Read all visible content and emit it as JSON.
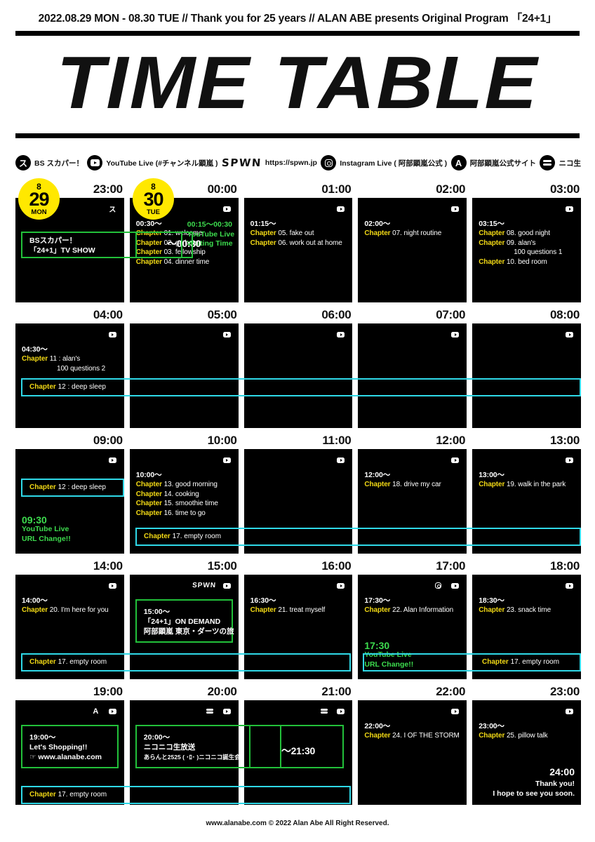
{
  "header": {
    "headline": "2022.08.29 MON - 08.30 TUE // Thank you for 25 years // ALAN ABE presents Original Program 「24+1」",
    "title": "TIME TABLE"
  },
  "legend": [
    {
      "icon": "skyperfectv-icon",
      "glyph": "ス",
      "label": "BS スカパー！"
    },
    {
      "icon": "youtube-icon",
      "glyph": "",
      "label": "YouTube Live (#チャンネル顕嵐 )"
    },
    {
      "icon": "spwn-logo",
      "glyph": "SPWN",
      "label": "https://spwn.jp"
    },
    {
      "icon": "instagram-icon",
      "glyph": "",
      "label": "Instagram Live ( 阿部顕嵐公式 )"
    },
    {
      "icon": "alanabe-site-icon",
      "glyph": "A",
      "label": "阿部顕嵐公式サイト"
    },
    {
      "icon": "niconico-icon",
      "glyph": "",
      "label": "ニコ生"
    }
  ],
  "day_badges": [
    {
      "month": "8",
      "day": "29",
      "weekday": "MON"
    },
    {
      "month": "8",
      "day": "30",
      "weekday": "TUE"
    }
  ],
  "colors": {
    "accent_yellow": "#ffe800",
    "chapter_yellow": "#f2d915",
    "green": "#22c03a",
    "green_text": "#3ddc4e",
    "cyan": "#2fd9e8",
    "cell_bg": "#000000"
  },
  "rows": [
    {
      "times": [
        "23:00",
        "00:00",
        "01:00",
        "02:00",
        "03:00"
      ],
      "cells": [
        {
          "name": "cell-2300",
          "icons": [
            "skyperfectv-icon"
          ],
          "lines": []
        },
        {
          "name": "cell-0000",
          "icons": [
            "youtube-icon"
          ],
          "start": "00:30〜",
          "lines": [
            {
              "ch": "Chapter",
              "txt": " 01. welcome"
            },
            {
              "ch": "Chapter",
              "txt": " 02. go home"
            },
            {
              "ch": "Chapter",
              "txt": " 03. fellowship"
            },
            {
              "ch": "Chapter",
              "txt": " 04. dinner time"
            }
          ],
          "green_note": [
            "00:15〜00:30",
            "YouTube Live",
            "Waiting Time"
          ],
          "box_time": "〜00:30"
        },
        {
          "name": "cell-0100",
          "icons": [
            "youtube-icon"
          ],
          "start": "01:15〜",
          "lines": [
            {
              "ch": "Chapter",
              "txt": " 05. fake out"
            },
            {
              "ch": "Chapter",
              "txt": " 06. work out at home"
            }
          ]
        },
        {
          "name": "cell-0200",
          "icons": [
            "youtube-icon"
          ],
          "start": "02:00〜",
          "lines": [
            {
              "ch": "Chapter",
              "txt": " 07. night routine"
            }
          ]
        },
        {
          "name": "cell-0300",
          "icons": [
            "youtube-icon"
          ],
          "start": "03:15〜",
          "lines": [
            {
              "ch": "Chapter",
              "txt": " 08. good night"
            },
            {
              "ch": "Chapter",
              "txt": " 09. alan's"
            },
            {
              "ch": "",
              "txt": "100 questions 1",
              "indent": true
            },
            {
              "ch": "Chapter",
              "txt": " 10. bed room"
            }
          ]
        }
      ],
      "skyper_box": {
        "l1": "BSスカパー！",
        "l2": "「24+1」TV SHOW"
      }
    },
    {
      "times": [
        "04:00",
        "05:00",
        "06:00",
        "07:00",
        "08:00"
      ],
      "cells": [
        {
          "name": "cell-0400",
          "icons": [
            "youtube-icon"
          ],
          "start": "04:30〜",
          "lines": [
            {
              "ch": "Chapter",
              "txt": " 11 : alan's"
            },
            {
              "ch": "",
              "txt": "100 questions 2",
              "indent": true
            }
          ]
        },
        {
          "name": "cell-0500",
          "icons": [
            "youtube-icon"
          ],
          "lines": []
        },
        {
          "name": "cell-0600",
          "icons": [
            "youtube-icon"
          ],
          "lines": []
        },
        {
          "name": "cell-0700",
          "icons": [
            "youtube-icon"
          ],
          "lines": []
        },
        {
          "name": "cell-0800",
          "icons": [
            "youtube-icon"
          ],
          "lines": []
        }
      ],
      "cyan_bar": {
        "ch": "Chapter",
        "txt": " 12 : deep sleep"
      }
    },
    {
      "times": [
        "09:00",
        "10:00",
        "11:00",
        "12:00",
        "13:00"
      ],
      "cells": [
        {
          "name": "cell-0900",
          "icons": [
            "youtube-icon"
          ],
          "green_note": [
            "09:30",
            "YouTube Live",
            "URL Change!!"
          ],
          "lines": []
        },
        {
          "name": "cell-1000",
          "icons": [
            "youtube-icon"
          ],
          "start": "10:00〜",
          "lines": [
            {
              "ch": "Chapter",
              "txt": " 13. good morning"
            },
            {
              "ch": "Chapter",
              "txt": " 14. cooking"
            },
            {
              "ch": "Chapter",
              "txt": " 15. smoothie time"
            },
            {
              "ch": "Chapter",
              "txt": " 16. time to go"
            }
          ]
        },
        {
          "name": "cell-1100",
          "icons": [
            "youtube-icon"
          ],
          "lines": []
        },
        {
          "name": "cell-1200",
          "icons": [
            "youtube-icon"
          ],
          "start": "12:00〜",
          "lines": [
            {
              "ch": "Chapter",
              "txt": " 18. drive my car"
            }
          ]
        },
        {
          "name": "cell-1300",
          "icons": [
            "youtube-icon"
          ],
          "start": "13:00〜",
          "lines": [
            {
              "ch": "Chapter",
              "txt": " 19. walk in the park"
            }
          ]
        }
      ],
      "cyan_bar_top": {
        "ch": "Chapter",
        "txt": " 12 : deep sleep"
      },
      "cyan_bar": {
        "ch": "Chapter",
        "txt": " 17. empty room"
      }
    },
    {
      "times": [
        "14:00",
        "15:00",
        "16:00",
        "17:00",
        "18:00"
      ],
      "cells": [
        {
          "name": "cell-1400",
          "icons": [
            "youtube-icon"
          ],
          "start": "14:00〜",
          "lines": [
            {
              "ch": "Chapter",
              "txt": " 20. I'm here for you"
            }
          ]
        },
        {
          "name": "cell-1500",
          "icons": [
            "spwn-logo",
            "youtube-icon"
          ],
          "green_box": [
            "15:00〜",
            "「24+1」ON DEMAND",
            "阿部顕嵐 東京・ダーツの旅"
          ],
          "lines": []
        },
        {
          "name": "cell-1600",
          "icons": [
            "youtube-icon"
          ],
          "start": "16:30〜",
          "lines": [
            {
              "ch": "Chapter",
              "txt": " 21. treat myself"
            }
          ]
        },
        {
          "name": "cell-1700",
          "icons": [
            "instagram-icon",
            "youtube-icon"
          ],
          "start": "17:30〜",
          "lines": [
            {
              "ch": "Chapter",
              "txt": " 22. Alan Information"
            }
          ],
          "green_note": [
            "17:30",
            "YouTube Live",
            "URL Change!!"
          ]
        },
        {
          "name": "cell-1800",
          "icons": [
            "youtube-icon"
          ],
          "start": "18:30〜",
          "lines": [
            {
              "ch": "Chapter",
              "txt": " 23. snack time"
            }
          ]
        }
      ],
      "cyan_bar": {
        "ch": "Chapter",
        "txt": " 17. empty room"
      },
      "cyan_bar_right": {
        "ch": "Chapter",
        "txt": " 17. empty room"
      }
    },
    {
      "times": [
        "19:00",
        "20:00",
        "21:00",
        "22:00",
        "23:00"
      ],
      "cells": [
        {
          "name": "cell-1900",
          "icons": [
            "alanabe-site-icon",
            "youtube-icon"
          ],
          "green_box": [
            "19:00〜",
            "Let's Shopping!!",
            "☞ www.alanabe.com"
          ],
          "lines": []
        },
        {
          "name": "cell-2000",
          "icons": [
            "niconico-icon",
            "youtube-icon"
          ],
          "green_box": [
            "20:00〜",
            "ニコニコ生放送",
            "あらんと2525 ( ･ﾛ･ )ニコニコ誕生会"
          ],
          "lines": []
        },
        {
          "name": "cell-2100",
          "icons": [
            "niconico-icon",
            "youtube-icon"
          ],
          "box_time": "〜21:30",
          "lines": []
        },
        {
          "name": "cell-2200",
          "icons": [
            "youtube-icon"
          ],
          "start": "22:00〜",
          "lines": [
            {
              "ch": "Chapter",
              "txt": " 24. I OF THE STORM"
            }
          ]
        },
        {
          "name": "cell-2300",
          "icons": [
            "youtube-icon"
          ],
          "start": "23:00〜",
          "lines": [
            {
              "ch": "Chapter",
              "txt": " 25. pillow talk"
            }
          ],
          "ending": [
            "24:00",
            "Thank you!",
            "I  hope to see you soon."
          ]
        }
      ],
      "cyan_bar": {
        "ch": "Chapter",
        "txt": " 17. empty room"
      }
    }
  ],
  "footer": "www.alanabe.com © 2022 Alan Abe All Right Reserved."
}
